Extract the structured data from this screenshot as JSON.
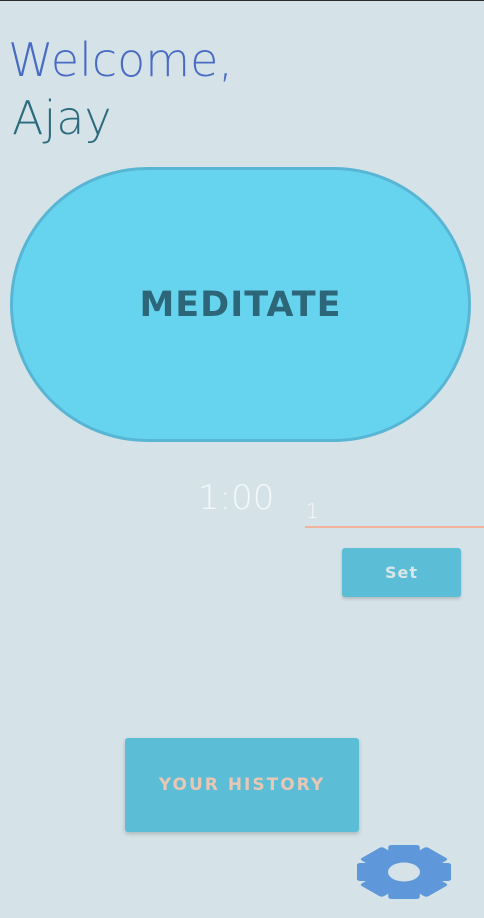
{
  "greeting": {
    "line1": "Welcome,",
    "line2": "Ajay"
  },
  "meditate_button": {
    "label": "MEDITATE"
  },
  "timer": {
    "display": "1:00"
  },
  "minutes_input": {
    "value": "1"
  },
  "set_button": {
    "label": "Set"
  },
  "history_button": {
    "label": "YOUR HISTORY"
  },
  "settings": {
    "icon": "gear-icon"
  },
  "colors": {
    "background": "#d5e3e8",
    "meditate_fill": "#66d4ef",
    "button_fill": "#5bbdd6",
    "input_underline": "#f0b49b",
    "gear": "#5e98db"
  }
}
